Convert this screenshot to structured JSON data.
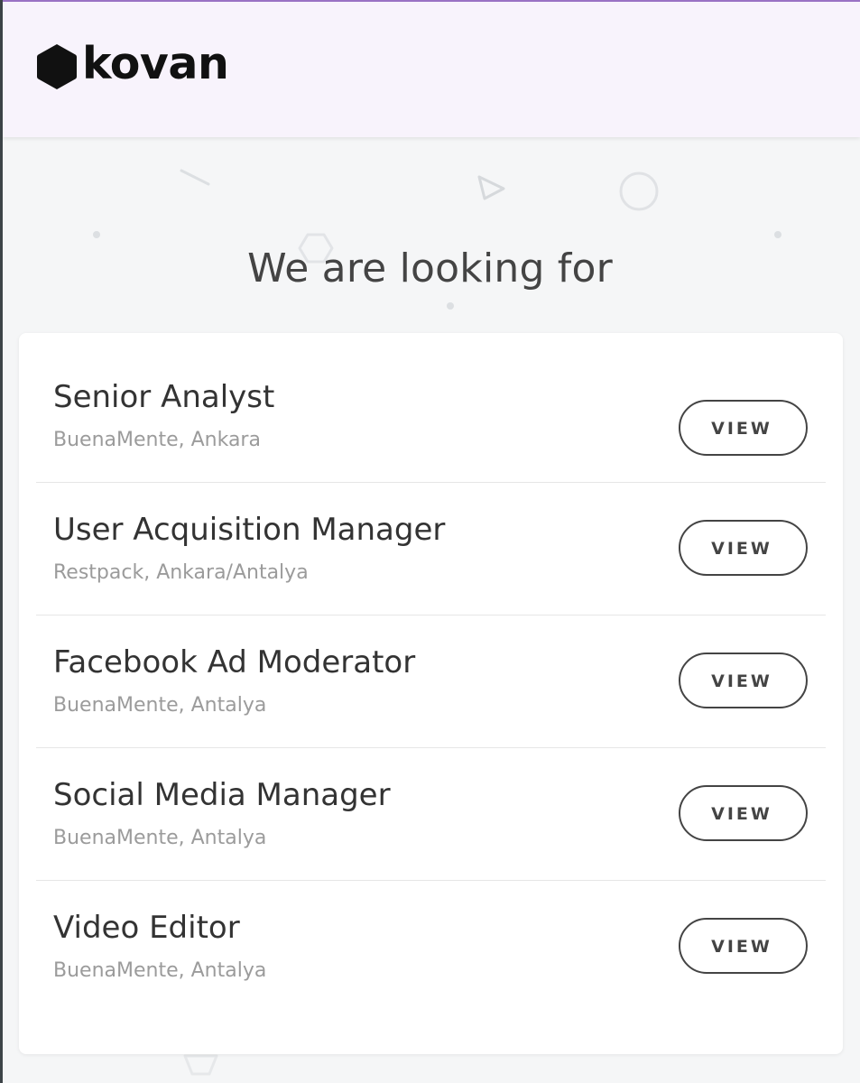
{
  "brand": {
    "name": "kovan"
  },
  "hero": {
    "title": "We are looking for"
  },
  "colors": {
    "header_bg": "#f8f3fc",
    "header_border": "#9a72c4",
    "page_bg": "#f5f6f7",
    "card_bg": "#ffffff",
    "button_border": "#444444",
    "meta_text": "#9b9b9b"
  },
  "jobs": [
    {
      "title": "Senior Analyst",
      "meta": "BuenaMente, Ankara",
      "button": "VIEW"
    },
    {
      "title": "User Acquisition Manager",
      "meta": "Restpack, Ankara/Antalya",
      "button": "VIEW"
    },
    {
      "title": "Facebook Ad Moderator",
      "meta": "BuenaMente, Antalya",
      "button": "VIEW"
    },
    {
      "title": "Social Media Manager",
      "meta": "BuenaMente, Antalya",
      "button": "VIEW"
    },
    {
      "title": "Video Editor",
      "meta": "BuenaMente, Antalya",
      "button": "VIEW"
    }
  ]
}
